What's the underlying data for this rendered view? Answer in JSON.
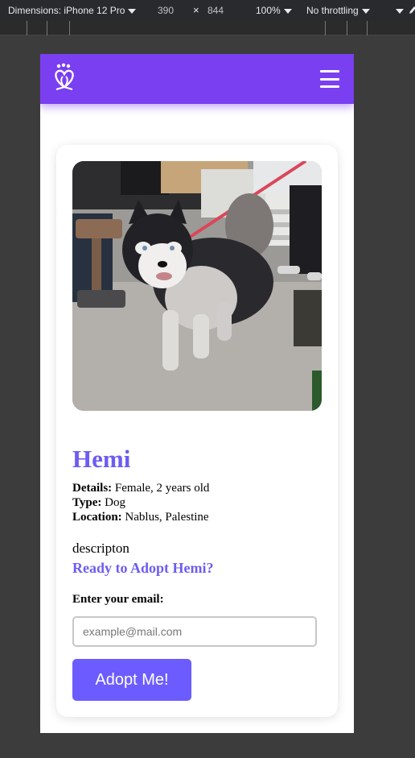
{
  "devtools": {
    "dimensions_label": "Dimensions: iPhone 12 Pro",
    "width": "390",
    "times": "×",
    "height": "844",
    "zoom": "100%",
    "throttling": "No throttling"
  },
  "navbar": {
    "logo_icon": "paw-heart-logo-icon",
    "menu_icon": "hamburger-menu-icon",
    "brand_color": "#7a3ff0"
  },
  "pet": {
    "photo_subject": "husky dog on red leash",
    "name": "Hemi",
    "details_label": "Details:",
    "details_value": " Female, 2 years old",
    "type_label": "Type:",
    "type_value": " Dog",
    "location_label": "Location:",
    "location_value": " Nablus, Palestine",
    "description": "descripton"
  },
  "adopt_form": {
    "heading": "Ready to Adopt Hemi?",
    "email_label": "Enter your email:",
    "email_placeholder": "example@mail.com",
    "email_value": "",
    "submit_label": "Adopt Me!",
    "accent_color": "#6c5cff"
  }
}
